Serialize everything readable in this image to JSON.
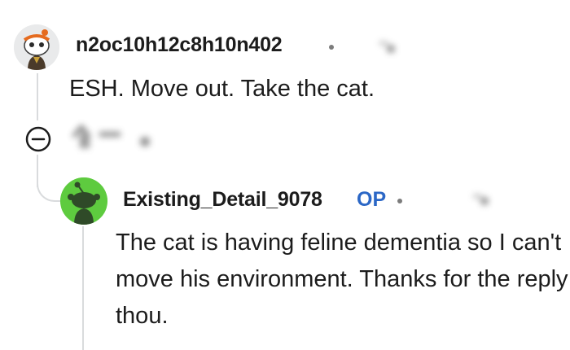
{
  "comments": [
    {
      "username": "n2oc10h12c8h10n402",
      "avatar_icon": "snoo-avatar-icon",
      "body": "ESH. Move out. Take the cat."
    },
    {
      "username": "Existing_Detail_9078",
      "badge": "OP",
      "avatar_icon": "snoo-avatar-icon",
      "body": "The cat is having feline dementia so I can't move his environment. Thanks for the reply thou."
    }
  ],
  "controls": {
    "collapse_icon": "minus-circle-icon",
    "upvote_icon": "arrow-up-icon"
  },
  "colors": {
    "op_badge": "#2b67c6",
    "thread_line": "#d9dbdd",
    "avatar2_bg": "#5ecb3f"
  }
}
